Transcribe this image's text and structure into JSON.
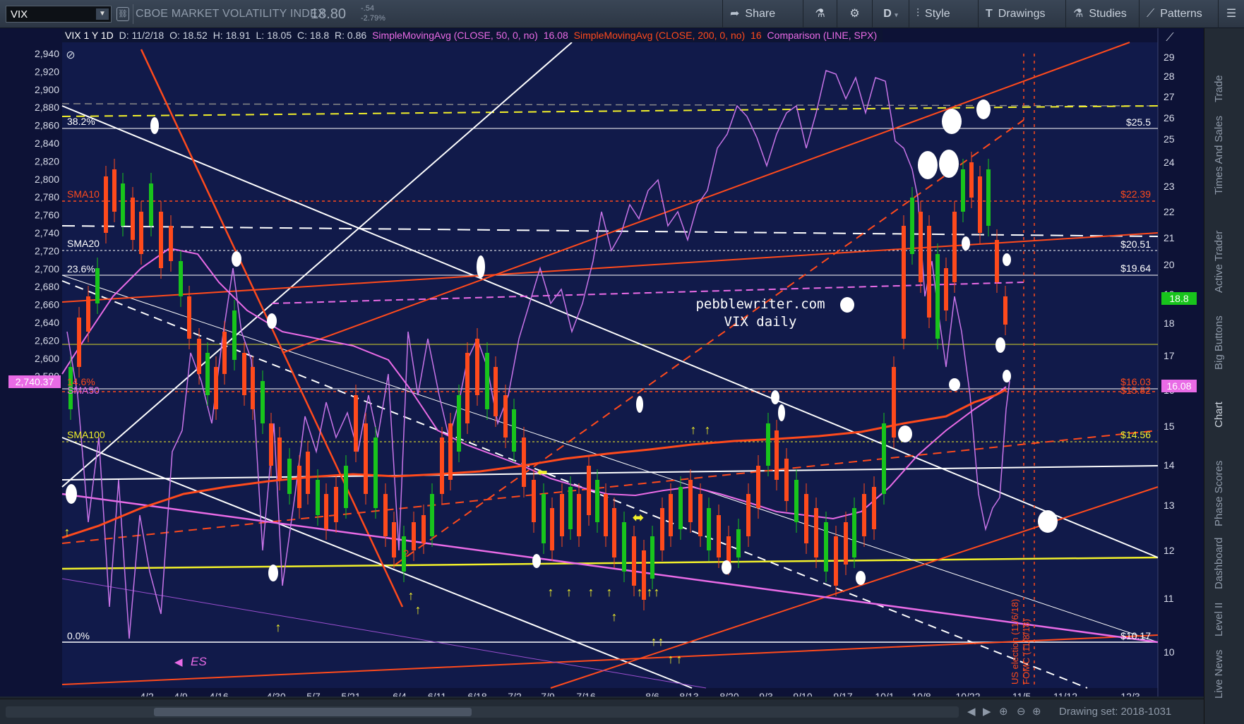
{
  "toolbar": {
    "symbol": "VIX",
    "description": "CBOE MARKET VOLATILITY INDEX",
    "last": "18.80",
    "change": "-.54",
    "change_pct": "-2.79%",
    "share": "Share",
    "timeframe": "D",
    "style": "Style",
    "drawings": "Drawings",
    "studies": "Studies",
    "patterns": "Patterns"
  },
  "legend": {
    "title": "VIX 1 Y 1D",
    "date": "D: 11/2/18",
    "open": "O: 18.52",
    "high": "H: 18.91",
    "low": "L: 18.05",
    "close": "C: 18.8",
    "range": "R: 0.86",
    "sma50": "SimpleMovingAvg (CLOSE, 50, 0, no)",
    "sma50_val": "16.08",
    "sma200": "SimpleMovingAvg (CLOSE, 200, 0, no)",
    "sma200_val": "16",
    "comparison": "Comparison (LINE, SPX)"
  },
  "left_axis": [
    "2,940",
    "2,920",
    "2,900",
    "2,880",
    "2,860",
    "2,840",
    "2,820",
    "2,800",
    "2,780",
    "2,760",
    "2,740",
    "2,720",
    "2,700",
    "2,680",
    "2,660",
    "2,640",
    "2,620",
    "2,600",
    "2,580"
  ],
  "left_marker": "2,740.37",
  "right_axis": [
    "29",
    "28",
    "27",
    "26",
    "25",
    "24",
    "23",
    "22",
    "21",
    "20",
    "19",
    "18",
    "17",
    "16",
    "15",
    "14",
    "13",
    "12",
    "11",
    "10"
  ],
  "right_markers": {
    "last": "18.8",
    "sma": "16.08"
  },
  "x_axis": [
    "4/2",
    "4/9",
    "4/16",
    "4/30",
    "5/7",
    "5/21",
    "6/4",
    "6/11",
    "6/18",
    "7/2",
    "7/9",
    "7/16",
    "8/6",
    "8/13",
    "8/20",
    "9/3",
    "9/10",
    "9/17",
    "10/1",
    "10/8",
    "10/22",
    "11/5",
    "11/12",
    "12/3"
  ],
  "annotations": {
    "watermark_site": "pebblewriter.com",
    "watermark_sub": "VIX daily",
    "fib_382": "38.2%",
    "fib_236": "23.6%",
    "fib_146": "14.6%",
    "fib_0": "0.0%",
    "sma10": "SMA10",
    "sma20": "SMA20",
    "sma50": "SMA50",
    "sma100": "SMA100",
    "lvl_255": "$25.5",
    "lvl_2239": "$22.39",
    "lvl_2051": "$20.51",
    "lvl_1964": "$19.64",
    "lvl_1603": "$16.03",
    "lvl_1582": "$15.82",
    "lvl_1456": "$14.56",
    "lvl_1017": "$10.17",
    "es_label": "ES",
    "election": "US election (11/6/18)",
    "fomc": "FOMC (11/8/18)",
    "question": "?"
  },
  "status": {
    "drawing_set": "Drawing set: 2018-1031"
  },
  "side_tabs": [
    "Trade",
    "Times And Sales",
    "Active Trader",
    "Big Buttons",
    "Chart",
    "Phase Scores",
    "Dashboard",
    "Level II",
    "Live News"
  ],
  "colors": {
    "chart_bg": "#111a4a",
    "up": "#18c41c",
    "down": "#ff4a1c",
    "sma50": "#e96be6",
    "spx": "#c874e8",
    "fib": "#ffffff",
    "red_line": "#ff4a1c",
    "yellow_line": "#f2f02a"
  }
}
